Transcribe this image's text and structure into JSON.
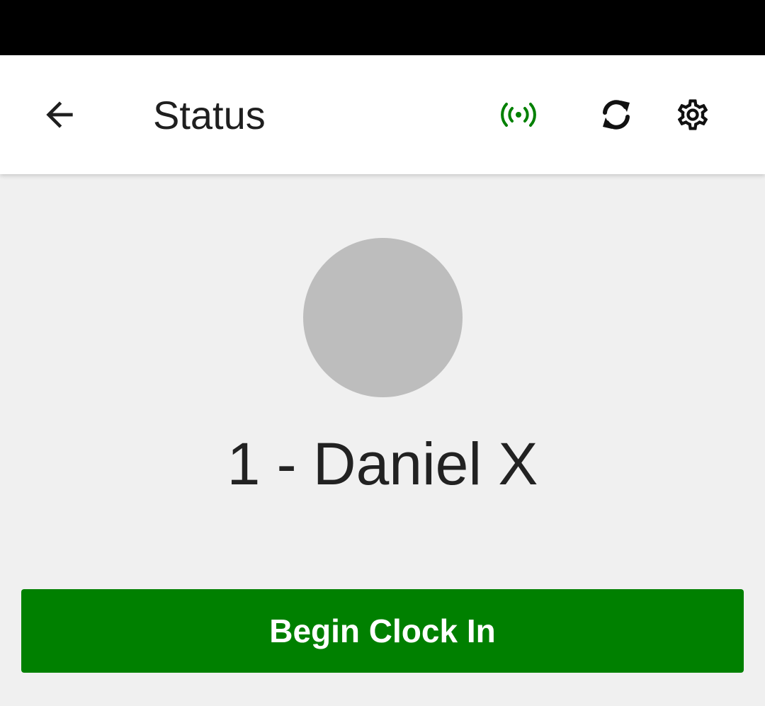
{
  "header": {
    "title": "Status",
    "icons": {
      "back": "arrow-left-icon",
      "broadcast": "broadcast-icon",
      "sync": "sync-icon",
      "settings": "gear-icon"
    }
  },
  "profile": {
    "name": "1 - Daniel X"
  },
  "actions": {
    "primary_label": "Begin Clock In"
  },
  "colors": {
    "accent_green": "#008000",
    "avatar_gray": "#bdbdbd",
    "background": "#f0f0f0",
    "status_bar": "#000000"
  }
}
